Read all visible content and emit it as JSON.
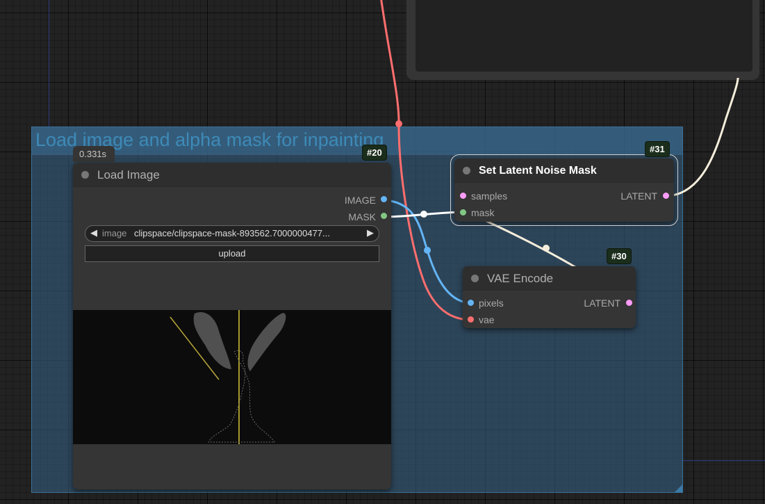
{
  "group": {
    "title": "Load image and alpha mask for inpainting"
  },
  "load_image_node": {
    "id_badge": "#20",
    "timing": "0.331s",
    "title": "Load Image",
    "outputs": [
      {
        "label": "IMAGE",
        "color": "#64b5f6"
      },
      {
        "label": "MASK",
        "color": "#81c784"
      }
    ],
    "image_widget": {
      "label": "image",
      "value": "clipspace/clipspace-mask-893562.7000000477...",
      "left_arrow": "◀",
      "right_arrow": "▶"
    },
    "upload_button": "upload"
  },
  "set_latent_noise_mask_node": {
    "id_badge": "#31",
    "title": "Set Latent Noise Mask",
    "inputs": [
      {
        "label": "samples",
        "color": "#ff9cf9"
      },
      {
        "label": "mask",
        "color": "#81c784"
      }
    ],
    "outputs": [
      {
        "label": "LATENT",
        "color": "#ff9cf9"
      }
    ]
  },
  "vae_encode_node": {
    "id_badge": "#30",
    "title": "VAE Encode",
    "inputs": [
      {
        "label": "pixels",
        "color": "#64b5f6"
      },
      {
        "label": "vae",
        "color": "#ff6e6e"
      }
    ],
    "outputs": [
      {
        "label": "LATENT",
        "color": "#ff9cf9"
      }
    ]
  },
  "colors": {
    "canvas_bg": "#222222",
    "node_bg": "#353535",
    "group_bg": "#335a7a",
    "link_vae": "#ff6e6e",
    "link_image": "#64b5f6",
    "link_mask": "#ffffff",
    "link_latent": "#f5eedc",
    "badge_bg": "#1b2d1b"
  }
}
